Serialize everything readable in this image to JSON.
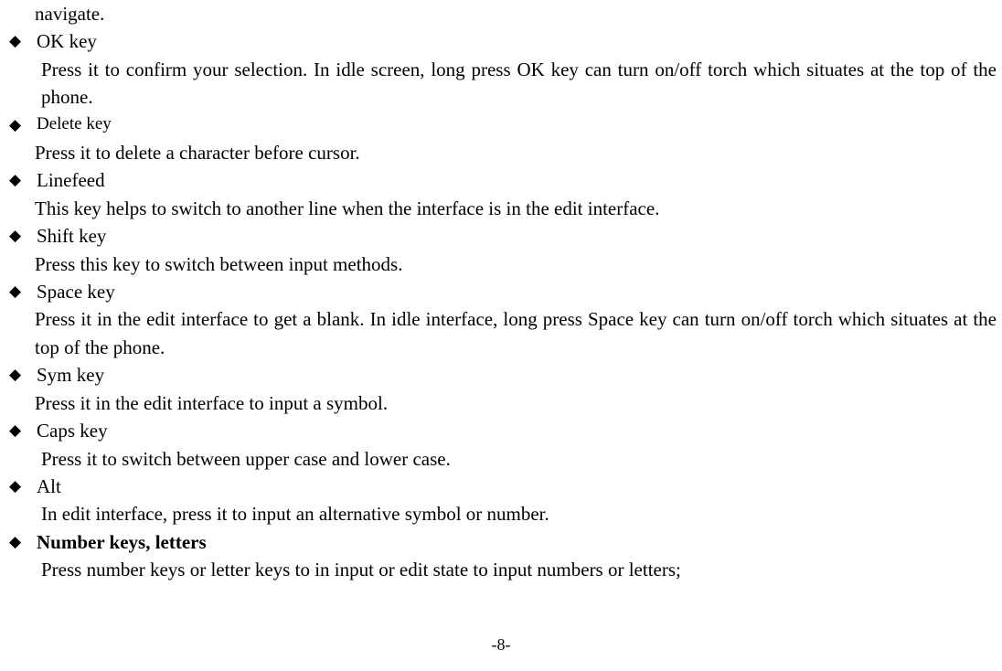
{
  "fragment": "navigate.",
  "items": [
    {
      "head": "OK key",
      "desc": "Press it to confirm your selection. In idle screen, long press OK key can turn on/off torch which situates at the top of the phone.",
      "indent": 1,
      "smaller": false,
      "bold": false
    },
    {
      "head": "Delete key",
      "desc": "Press it to delete a character before cursor.",
      "indent": 0,
      "smaller": true,
      "bold": false
    },
    {
      "head": "Linefeed",
      "desc": "This key helps to switch to another line when the interface is in the edit interface.",
      "indent": 0,
      "smaller": false,
      "bold": false
    },
    {
      "head": "Shift key",
      "desc": "Press this key to switch between input methods.",
      "indent": 0,
      "smaller": false,
      "bold": false
    },
    {
      "head": "Space key",
      "desc": "Press it in the edit interface to get a blank. In idle interface, long press Space key can turn on/off torch which situates at the top of the phone.",
      "indent": 0,
      "smaller": false,
      "bold": false
    },
    {
      "head": "Sym key",
      "desc": "Press it in the edit interface to input a symbol.",
      "indent": 0,
      "smaller": false,
      "bold": false
    },
    {
      "head": "Caps key",
      "desc": "Press it to switch between upper case and lower case.",
      "indent": 1,
      "smaller": false,
      "bold": false
    },
    {
      "head": "Alt",
      "desc": "In edit interface, press it to input an alternative symbol or number.",
      "indent": 1,
      "smaller": false,
      "bold": false
    },
    {
      "head": "Number keys, letters",
      "desc": "Press number keys or letter keys to in input or edit state to input numbers or letters;",
      "indent": 1,
      "smaller": false,
      "bold": true
    }
  ],
  "pageNumber": "-8-"
}
